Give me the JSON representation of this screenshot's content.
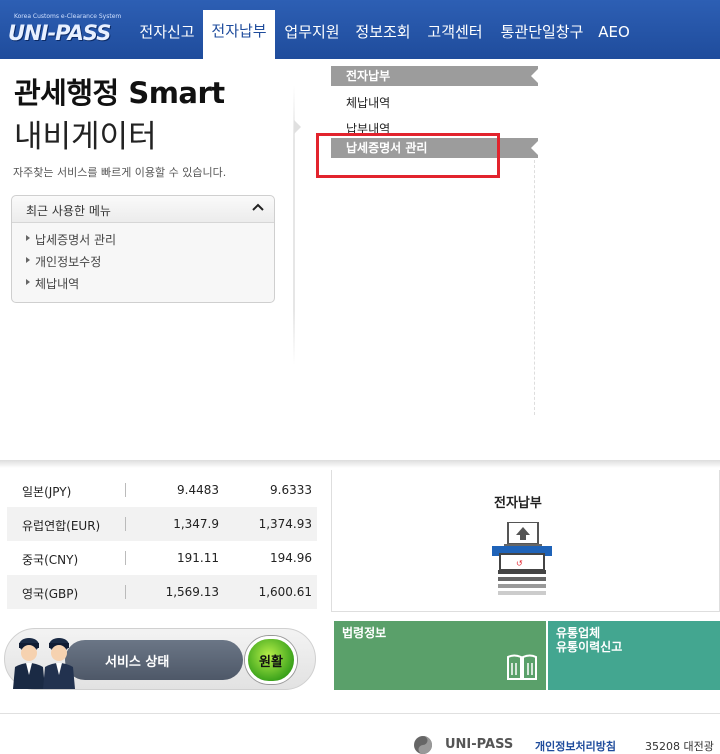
{
  "header": {
    "logo_sub": "Korea Customs e-Clearance System",
    "logo_main": "UNI-PASS",
    "nav": [
      {
        "label": "전자신고"
      },
      {
        "label": "전자납부"
      },
      {
        "label": "업무지원"
      },
      {
        "label": "정보조회"
      },
      {
        "label": "고객센터"
      },
      {
        "label": "통관단일창구"
      },
      {
        "label": "AEO"
      }
    ],
    "active_nav": "전자납부"
  },
  "navigator": {
    "title_line1": "관세행정 Smart",
    "title_line2": "내비게이터",
    "subtitle": "자주찾는 서비스를 빠르게 이용할 수 있습니다.",
    "recent": {
      "header": "최근 사용한 메뉴",
      "items": [
        "납세증명서 관리",
        "개인정보수정",
        "체납내역"
      ]
    }
  },
  "submenu": {
    "header": "전자납부",
    "items": [
      "체납내역",
      "납부내역"
    ],
    "active_item": "납세증명서 관리"
  },
  "rates": [
    {
      "currency": "일본(JPY)",
      "v1": "9.4483",
      "v2": "9.6333"
    },
    {
      "currency": "유럽연합(EUR)",
      "v1": "1,347.9",
      "v2": "1,374.93"
    },
    {
      "currency": "중국(CNY)",
      "v1": "191.11",
      "v2": "194.96"
    },
    {
      "currency": "영국(GBP)",
      "v1": "1,569.13",
      "v2": "1,600.61"
    }
  ],
  "epay": {
    "label": "전자납부"
  },
  "service": {
    "label": "서비스 상태",
    "status": "원활"
  },
  "tiles": {
    "law": "법령정보",
    "dist_line1": "유통업체",
    "dist_line2": "유통이력신고"
  },
  "footer": {
    "logo": "UNI-PASS",
    "privacy": "개인정보처리방침",
    "address": "35208 대전광"
  },
  "colors": {
    "nav_bg": "#2d5fb4",
    "highlight": "#e2232d",
    "tile_law": "#5aa06a",
    "tile_dist": "#43a690",
    "status_green": "#3da41c"
  }
}
